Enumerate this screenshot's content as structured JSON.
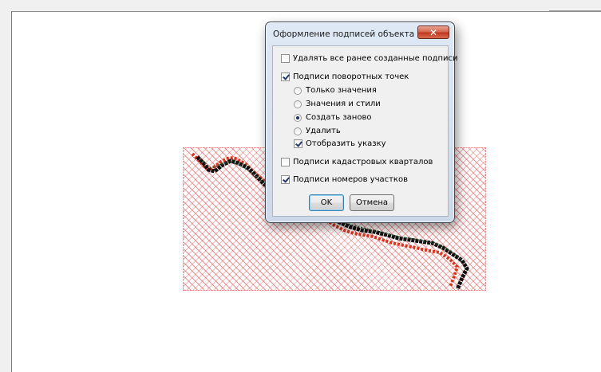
{
  "dialog": {
    "title": "Оформление подписей объекта з...",
    "close_symbol": "✕",
    "options": {
      "delete_all_labels": {
        "label": "Удалять все ранее созданные подписи",
        "checked": false
      },
      "turning_points_labels": {
        "label": "Подписи поворотных точек",
        "checked": true
      },
      "radio_group": [
        {
          "label": "Только значения",
          "selected": false
        },
        {
          "label": "Значения и стили",
          "selected": false
        },
        {
          "label": "Создать заново",
          "selected": true
        },
        {
          "label": "Удалить",
          "selected": false
        }
      ],
      "show_pointer": {
        "label": "Отобразить указку",
        "checked": true
      },
      "cadastral_quarters_labels": {
        "label": "Подписи кадастровых кварталов",
        "checked": false
      },
      "parcel_numbers_labels": {
        "label": "Подписи номеров участков",
        "checked": true
      }
    },
    "ok_label": "OK",
    "cancel_label": "Отмена"
  },
  "colors": {
    "hatch": "#dc3c3c",
    "boundary_red": "#d9341c",
    "boundary_black": "#111111",
    "dialog_frame": "#cdd9e8",
    "close_button": "#c0391f"
  }
}
